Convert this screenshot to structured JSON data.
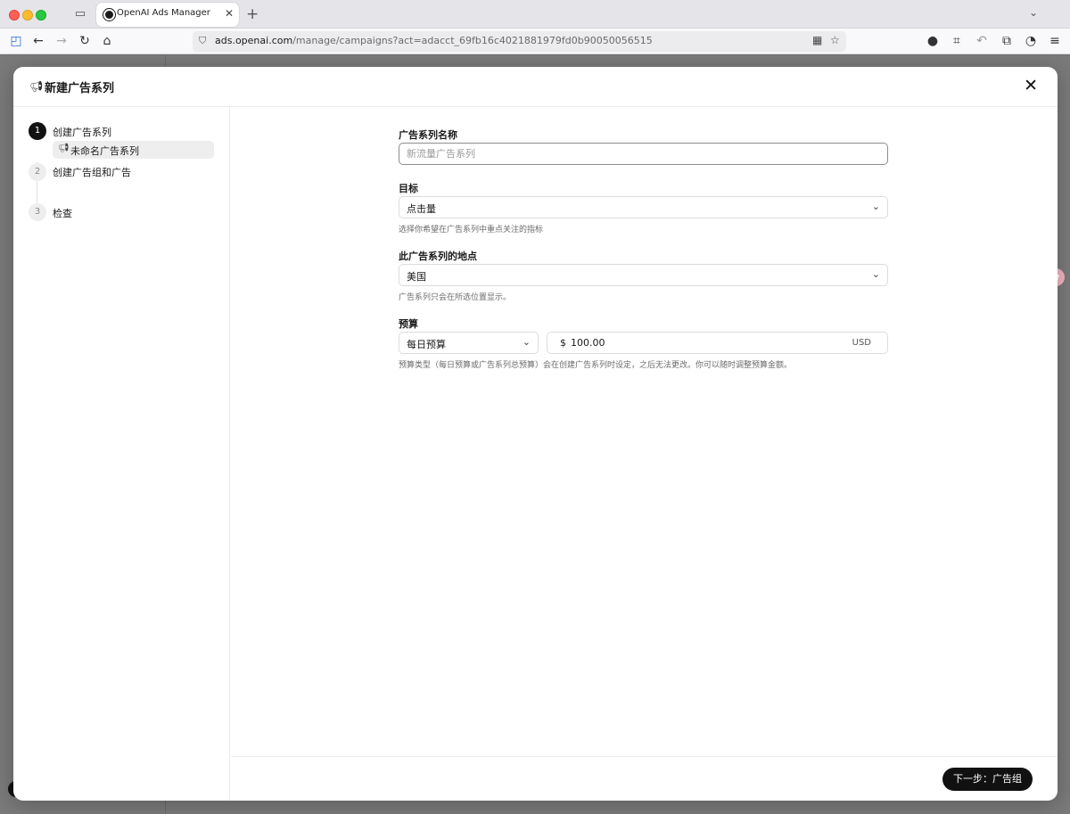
{
  "browser": {
    "tab_title": "OpenAI Ads Manager",
    "url_domain": "ads.openai.com",
    "url_path": "/manage/campaigns?act=adacct_69fb16c4021881979fd0b90050056515"
  },
  "modal": {
    "title": "新建广告系列",
    "steps": [
      {
        "number": "1",
        "label": "创建广告系列",
        "active": true
      },
      {
        "number": "2",
        "label": "创建广告组和广告",
        "active": false
      },
      {
        "number": "3",
        "label": "检查",
        "active": false
      }
    ],
    "substep_label": "未命名广告系列",
    "form": {
      "name_label": "广告系列名称",
      "name_placeholder": "新流量广告系列",
      "name_value": "",
      "objective_label": "目标",
      "objective_value": "点击量",
      "objective_help": "选择你希望在广告系列中重点关注的指标",
      "location_label": "此广告系列的地点",
      "location_value": "美国",
      "location_help": "广告系列只会在所选位置显示。",
      "budget_label": "预算",
      "budget_type_value": "每日预算",
      "budget_currency_symbol": "$",
      "budget_amount": "100.00",
      "budget_currency": "USD",
      "budget_help": "预算类型（每日预算或广告系列总预算）会在创建广告系列时设定，之后无法更改。你可以随时调整预算金额。"
    },
    "next_button_label": "下一步：广告组"
  },
  "icons": {
    "browser": [
      "tab-overview-icon",
      "openai-favicon-icon",
      "tab-close-icon",
      "new-tab-icon",
      "tab-list-icon",
      "sidebar-icon",
      "back-icon",
      "forward-icon",
      "reload-icon",
      "home-icon",
      "site-info-icon",
      "qr-code-icon",
      "bookmark-star-icon",
      "profile-avatar-icon",
      "screenshot-crop-icon",
      "undo-icon",
      "extensions-icon",
      "shield-icon",
      "menu-icon"
    ],
    "modal": [
      "megaphone-icon",
      "close-icon",
      "chevron-down-icon"
    ]
  }
}
